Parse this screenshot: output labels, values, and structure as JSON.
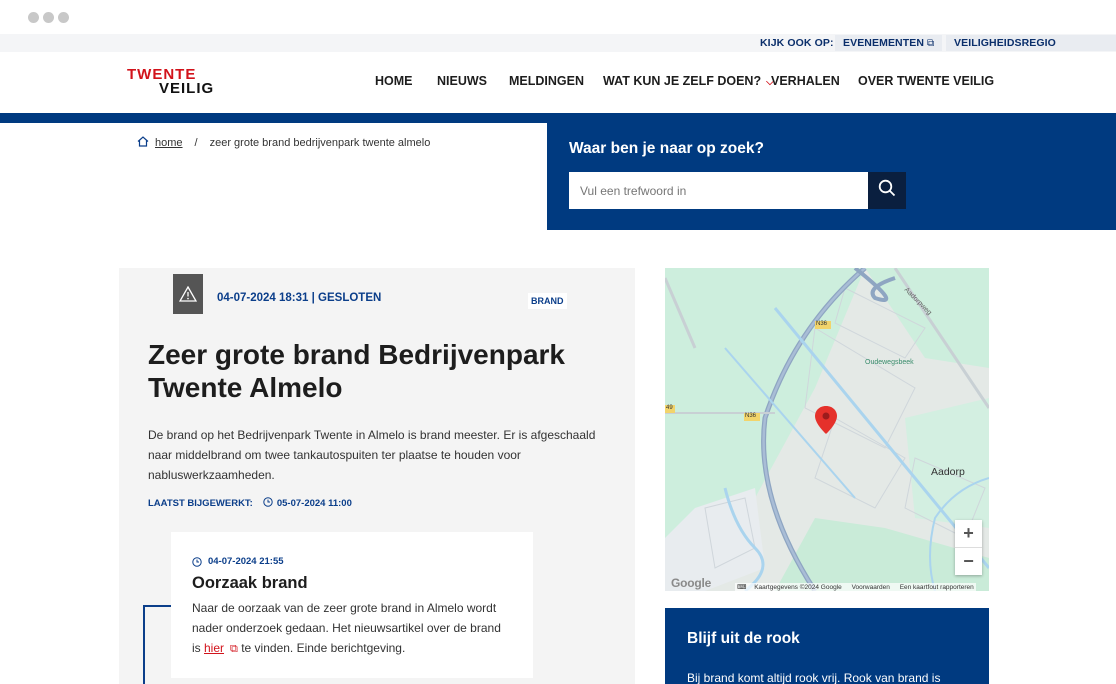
{
  "utility": {
    "label": "KIJK OOK OP:",
    "links": [
      {
        "label": "EVENEMENTEN"
      },
      {
        "label": "VEILIGHEIDSREGIO TWENTE"
      }
    ]
  },
  "logo": {
    "line1": "TWENTE",
    "line2": "VEILIG"
  },
  "nav": {
    "items": [
      {
        "label": "HOME"
      },
      {
        "label": "NIEUWS"
      },
      {
        "label": "MELDINGEN"
      },
      {
        "label": "WAT KUN JE ZELF DOEN?"
      },
      {
        "label": "VERHALEN"
      },
      {
        "label": "OVER TWENTE VEILIG"
      }
    ]
  },
  "breadcrumb": {
    "home": "home",
    "separator": "/",
    "current": "zeer grote brand bedrijvenpark twente almelo"
  },
  "search": {
    "title": "Waar ben je naar op zoek?",
    "placeholder": "Vul een trefwoord in"
  },
  "incident": {
    "meta": "04-07-2024 18:31 | GESLOTEN",
    "tag": "BRAND",
    "title": "Zeer grote brand Bedrijvenpark Twente Almelo",
    "description": "De brand op het Bedrijvenpark Twente in Almelo is brand meester. Er is afgeschaald naar middelbrand om twee tankautospuiten ter plaatse te houden voor nabluswerkzaamheden.",
    "updated_label": "LAATST BIJGEWERKT:",
    "updated_value": "05-07-2024 11:00"
  },
  "update": {
    "time": "04-07-2024 21:55",
    "title": "Oorzaak brand",
    "text_before": "Naar de oorzaak van de zeer grote brand in Almelo wordt nader onderzoek gedaan. Het nieuwsartikel over de brand is ",
    "link": "hier",
    "text_after": " te vinden. Einde berichtgeving."
  },
  "map": {
    "places": {
      "aadorp": "Aadorp",
      "oudewegsbeek": "Oudewegsbeek",
      "aadorpweg": "Aadorpweg",
      "n36a": "N36",
      "n36b": "N36",
      "n49": "49"
    },
    "zoom_in": "+",
    "zoom_out": "−",
    "google": "Google",
    "attribution": [
      "Kaartgegevens ©2024 Google",
      "Voorwaarden",
      "Een kaartfout rapporteren"
    ]
  },
  "smoke": {
    "title": "Blijf uit de rook",
    "text": "Bij brand komt altijd rook vrij. Rook van brand is"
  },
  "colors": {
    "brand_blue": "#003a80",
    "brand_red": "#d2131b",
    "dark_blue": "#0a1f3f"
  }
}
